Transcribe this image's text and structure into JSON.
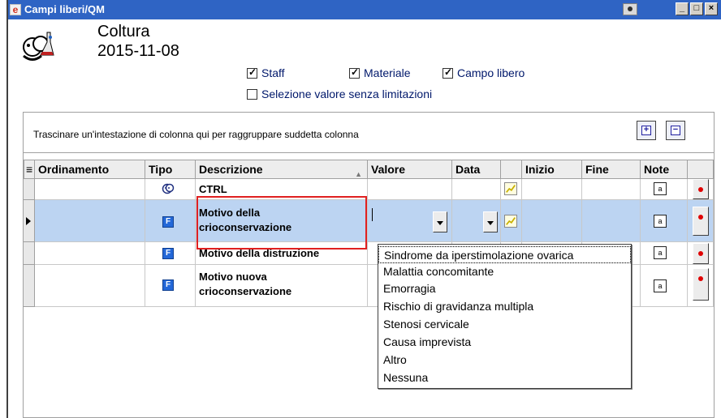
{
  "window": {
    "title": "Campi liberi/QM",
    "buttons": {
      "minimize": "_",
      "maximize": "□",
      "close": "×"
    }
  },
  "header": {
    "title": "Coltura",
    "date": "2015-11-08"
  },
  "options": {
    "staff": {
      "label": "Staff",
      "checked": true
    },
    "materiale": {
      "label": "Materiale",
      "checked": true
    },
    "campo_libero": {
      "label": "Campo libero",
      "checked": true
    },
    "selezione": {
      "label": "Selezione valore senza limitazioni",
      "checked": false
    }
  },
  "grid": {
    "group_hint": "Trascinare un'intestazione di colonna qui per raggruppare suddetta colonna",
    "expand_label": "+",
    "collapse_label": "−",
    "columns": {
      "ordinamento": "Ordinamento",
      "tipo": "Tipo",
      "descrizione": "Descrizione",
      "valore": "Valore",
      "data": "Data",
      "inizio": "Inizio",
      "fine": "Fine",
      "note": "Note"
    },
    "rows": [
      {
        "tipo": "ctrl-icon",
        "descrizione": "CTRL"
      },
      {
        "tipo": "f-icon",
        "descrizione_1": "Motivo della",
        "descrizione_2": "crioconservazione",
        "selected": true
      },
      {
        "tipo": "f-icon",
        "descrizione": "Motivo della distruzione"
      },
      {
        "tipo": "f-icon",
        "descrizione_1": "Motivo nuova",
        "descrizione_2": "crioconservazione"
      }
    ]
  },
  "dropdown": {
    "options": [
      "Sindrome da iperstimolazione ovarica",
      "Malattia concomitante",
      "Emorragia",
      "Rischio di gravidanza multipla",
      "Stenosi cervicale",
      "Causa imprevista",
      "Altro",
      "Nessuna"
    ]
  },
  "colors": {
    "titlebar": "#2f64c4",
    "selected_row": "#bcd4f2",
    "highlight": "#e02020",
    "label_text": "#00186b"
  }
}
